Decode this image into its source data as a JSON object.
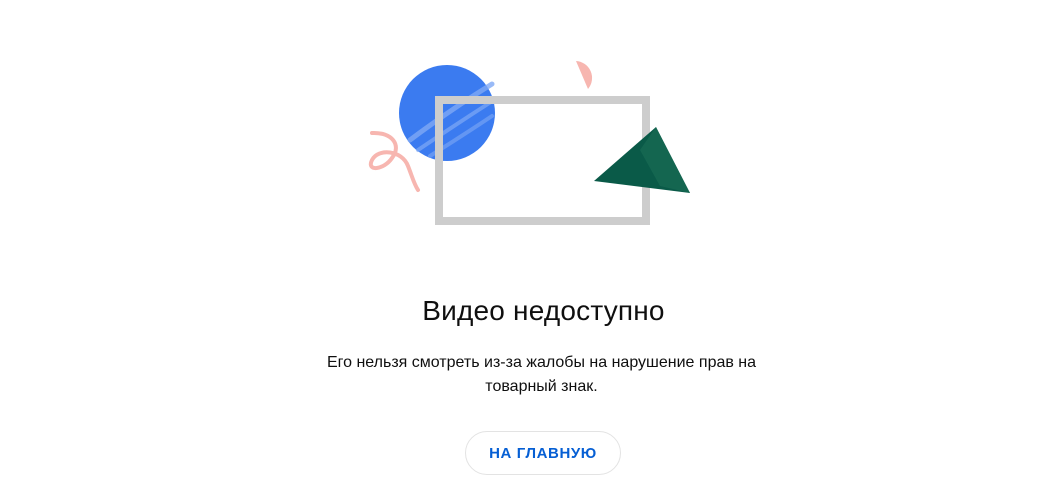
{
  "error": {
    "title": "Видео недоступно",
    "message": "Его нельзя смотреть из-за жалобы на нарушение прав на товарный знак."
  },
  "actions": {
    "home_label": "НА ГЛАВНУЮ"
  },
  "illustration": {
    "name": "video-unavailable-illustration",
    "colors": {
      "circle": "#3b7bf0",
      "frame": "#cdcdcd",
      "triangle": "#0a5a48",
      "accent": "#f7b6b0"
    }
  }
}
